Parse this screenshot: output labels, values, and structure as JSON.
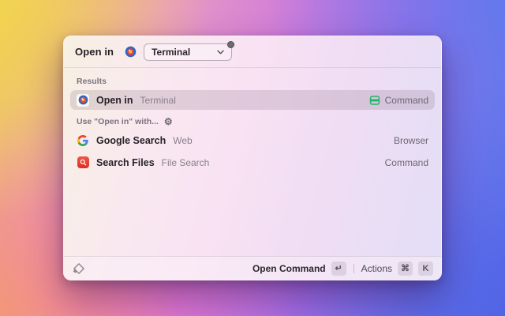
{
  "header": {
    "label": "Open in",
    "dropdown": {
      "value": "Terminal",
      "badge": "notification-dot"
    }
  },
  "sections": {
    "results": "Results",
    "use_with": "Use \"Open in\" with..."
  },
  "rows": [
    {
      "title": "Open in",
      "subtitle": "Terminal",
      "accessory": "Command",
      "accessory_icon": "terminal-window-green",
      "selected": true
    },
    {
      "title": "Google Search",
      "subtitle": "Web",
      "accessory": "Browser",
      "selected": false
    },
    {
      "title": "Search Files",
      "subtitle": "File Search",
      "accessory": "Command",
      "selected": false
    }
  ],
  "footer": {
    "primary_label": "Open Command",
    "primary_key": "↵",
    "actions_label": "Actions",
    "action_keys": [
      "⌘",
      "K"
    ]
  },
  "icons": {
    "gear": "⚙",
    "open_in": "circular red-blue app icon",
    "google": "google-g-multicolor",
    "search_files": "white magnifier on red square",
    "raycast_logo": "diamond outline"
  },
  "colors": {
    "command_green": "#22b467",
    "files_red": "#e03a2e",
    "google_blue": "#4285F4",
    "google_green": "#34A853",
    "google_yellow": "#FBBC05",
    "google_red": "#EA4335"
  }
}
